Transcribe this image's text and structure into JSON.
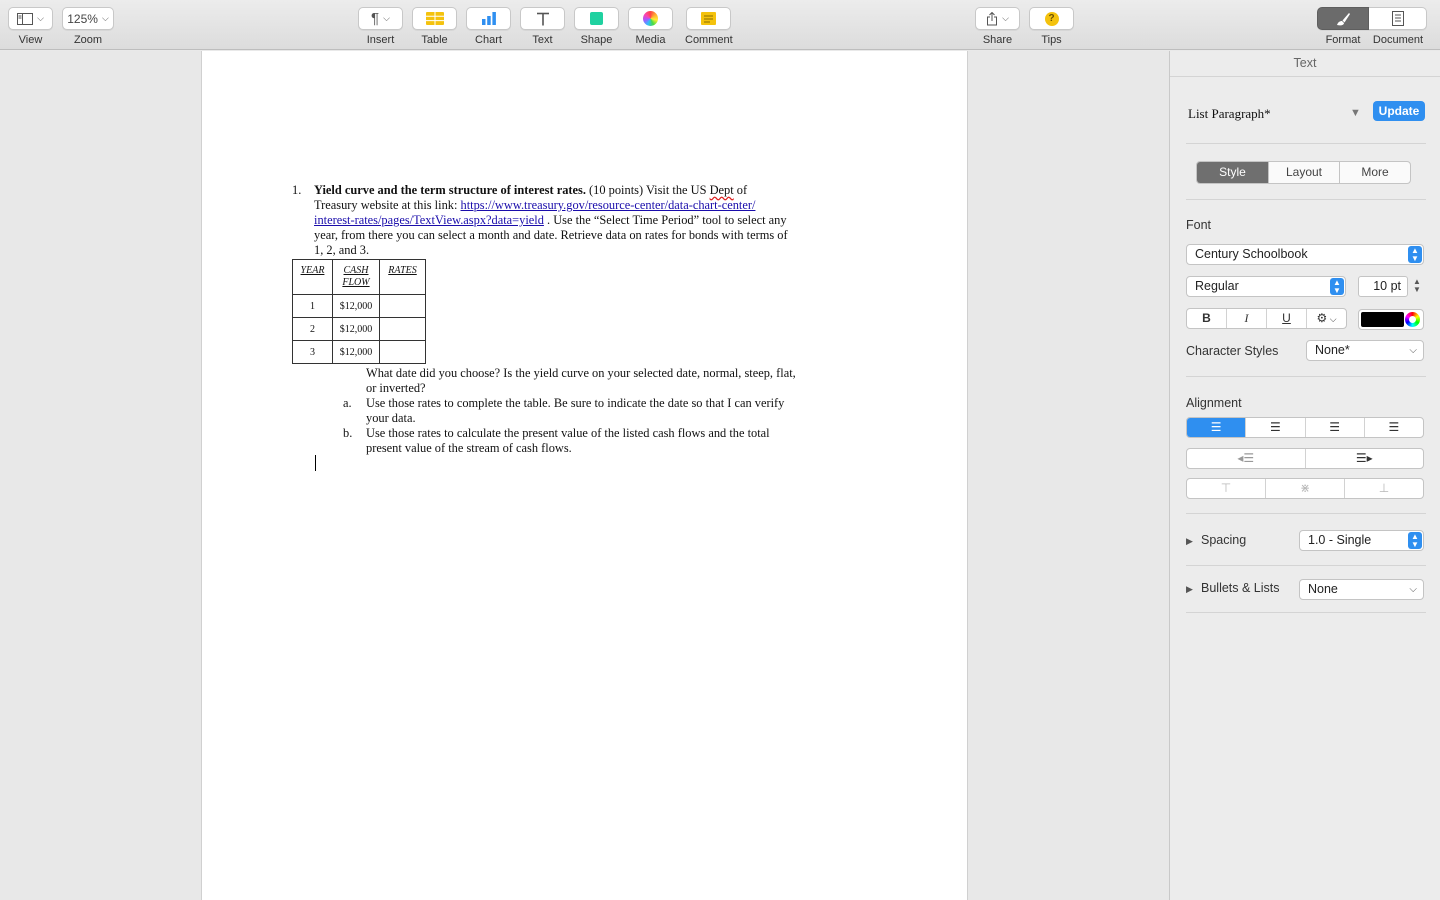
{
  "toolbar": {
    "view_label": "View",
    "zoom_value": "125%",
    "zoom_label": "Zoom",
    "insert_label": "Insert",
    "table_label": "Table",
    "chart_label": "Chart",
    "text_label": "Text",
    "shape_label": "Shape",
    "media_label": "Media",
    "comment_label": "Comment",
    "share_label": "Share",
    "tips_label": "Tips",
    "format_label": "Format",
    "document_label": "Document"
  },
  "document": {
    "item_number": "1.",
    "heading": "Yield curve and the term structure of interest rates.",
    "line1_rest_pre": " (10 points) Visit the US ",
    "line1_dept": "Dept",
    "line1_of": " of",
    "line2_pre": "Treasury website at this link: ",
    "link_part1": "https://www.treasury.gov/resource-center/data-chart-center/",
    "link_part2": "interest-rates/pages/TextView.aspx?data=yield",
    "line3_rest": " . Use the “Select Time Period” tool to select any",
    "line4": "year, from there you can select a month and date. Retrieve data on rates for bonds with terms of",
    "line5": "1, 2, and 3.",
    "table": {
      "headers": [
        "YEAR",
        "CASH FLOW",
        "RATES"
      ],
      "rows": [
        [
          "1",
          "$12,000",
          ""
        ],
        [
          "2",
          "$12,000",
          ""
        ],
        [
          "3",
          "$12,000",
          ""
        ]
      ]
    },
    "q_line1": "What date did you choose? Is the yield curve on your selected date, normal, steep, flat,",
    "q_line2": "or inverted?",
    "a_marker": "a.",
    "a_line1": "Use those rates to complete the table. Be sure to indicate the date so that I can verify",
    "a_line2": "your data.",
    "b_marker": "b.",
    "b_line1": "Use those rates to calculate the present value of the listed cash flows and the total",
    "b_line2": "present value of the stream of cash flows."
  },
  "inspector": {
    "title": "Text",
    "paragraph_style": "List Paragraph*",
    "update_label": "Update",
    "tabs": [
      "Style",
      "Layout",
      "More"
    ],
    "active_tab": "Style",
    "font_label": "Font",
    "font_family": "Century Schoolbook",
    "font_typeface": "Regular",
    "font_size": "10 pt",
    "bold_label": "B",
    "italic_label": "I",
    "underline_label": "U",
    "text_color": "#000000",
    "character_styles_label": "Character Styles",
    "character_style_value": "None*",
    "alignment_label": "Alignment",
    "spacing_label": "Spacing",
    "spacing_value": "1.0 - Single",
    "bullets_label": "Bullets & Lists",
    "bullets_value": "None"
  },
  "colors": {
    "accent": "#2f8ff0",
    "link": "#1a0dab"
  },
  "icons": {
    "view": "sidebar-icon",
    "insert": "pilcrow-icon",
    "table": "table-icon",
    "chart": "bar-chart-icon",
    "text": "text-box-icon",
    "shape": "shape-icon",
    "media": "media-flower-icon",
    "comment": "comment-note-icon",
    "share": "share-icon",
    "tips": "question-icon",
    "format": "paintbrush-icon",
    "document": "document-icon"
  }
}
